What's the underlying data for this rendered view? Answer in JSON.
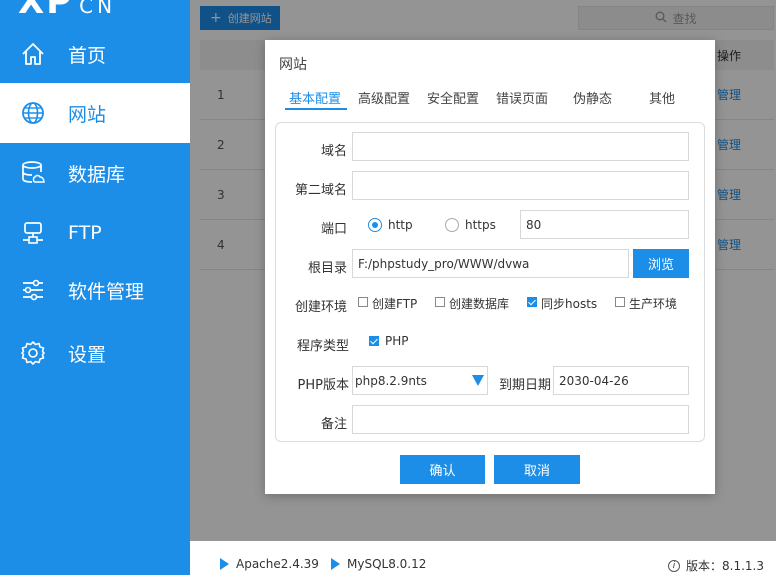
{
  "colors": {
    "primary": "#1d8ee8",
    "sidebar_bg": "#1d8ee8",
    "overlay": "rgba(0,0,0,0.42)"
  },
  "logo": {
    "main": "XP",
    "suffix": "CN"
  },
  "sidebar": {
    "items": [
      {
        "label": "首页",
        "icon": "home-icon"
      },
      {
        "label": "网站",
        "icon": "globe-icon",
        "active": true
      },
      {
        "label": "数据库",
        "icon": "database-icon"
      },
      {
        "label": "FTP",
        "icon": "ftp-server-icon"
      },
      {
        "label": "软件管理",
        "icon": "sliders-icon"
      },
      {
        "label": "设置",
        "icon": "gear-icon"
      }
    ]
  },
  "toolbar": {
    "create_label": "创建网站",
    "search_label": "查找"
  },
  "table": {
    "ops_header": "操作",
    "rows": [
      {
        "num": "1",
        "action": "管理"
      },
      {
        "num": "2",
        "action": "管理"
      },
      {
        "num": "3",
        "action": "管理"
      },
      {
        "num": "4",
        "action": "管理"
      }
    ]
  },
  "modal": {
    "title": "网站",
    "tabs": [
      "基本配置",
      "高级配置",
      "安全配置",
      "错误页面",
      "伪静态",
      "其他"
    ],
    "active_tab": 0,
    "fields": {
      "domain_label": "域名",
      "domain_value": "",
      "second_domain_label": "第二域名",
      "second_domain_value": "",
      "port_label": "端口",
      "http_label": "http",
      "https_label": "https",
      "protocol_selected": "http",
      "port_value": "80",
      "root_label": "根目录",
      "root_value": "F:/phpstudy_pro/WWW/dvwa",
      "browse_label": "浏览",
      "env_label": "创建环境",
      "env_options": [
        {
          "label": "创建FTP",
          "checked": false
        },
        {
          "label": "创建数据库",
          "checked": false
        },
        {
          "label": "同步hosts",
          "checked": true
        },
        {
          "label": "生产环境",
          "checked": false
        }
      ],
      "program_type_label": "程序类型",
      "program_type_option": {
        "label": "PHP",
        "checked": true
      },
      "php_version_label": "PHP版本",
      "php_version_value": "php8.2.9nts",
      "expire_label": "到期日期",
      "expire_value": "2030-04-26",
      "remark_label": "备注",
      "remark_value": ""
    },
    "confirm_label": "确认",
    "cancel_label": "取消"
  },
  "footer": {
    "apache": "Apache2.4.39",
    "mysql": "MySQL8.0.12",
    "version_label": "版本：8.1.1.3"
  }
}
